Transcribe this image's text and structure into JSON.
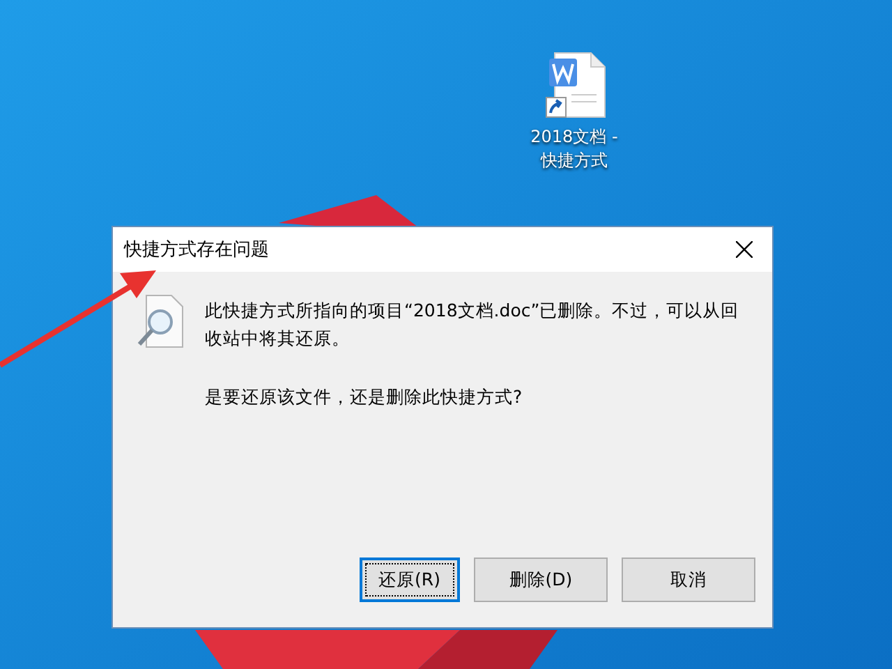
{
  "desktop": {
    "icons": [
      {
        "label": "2018文档 - 快捷方式",
        "selected": false
      }
    ]
  },
  "dialog": {
    "title": "快捷方式存在问题",
    "message": "此快捷方式所指向的项目“2018文档.doc”已删除。不过，可以从回收站中将其还原。",
    "question": "是要还原该文件，还是删除此快捷方式?",
    "buttons": [
      {
        "label": "还原(R)",
        "focused": true
      },
      {
        "label": "删除(D)",
        "focused": false
      },
      {
        "label": "取消",
        "focused": false
      }
    ]
  },
  "annotation": {
    "kind": "arrow"
  }
}
